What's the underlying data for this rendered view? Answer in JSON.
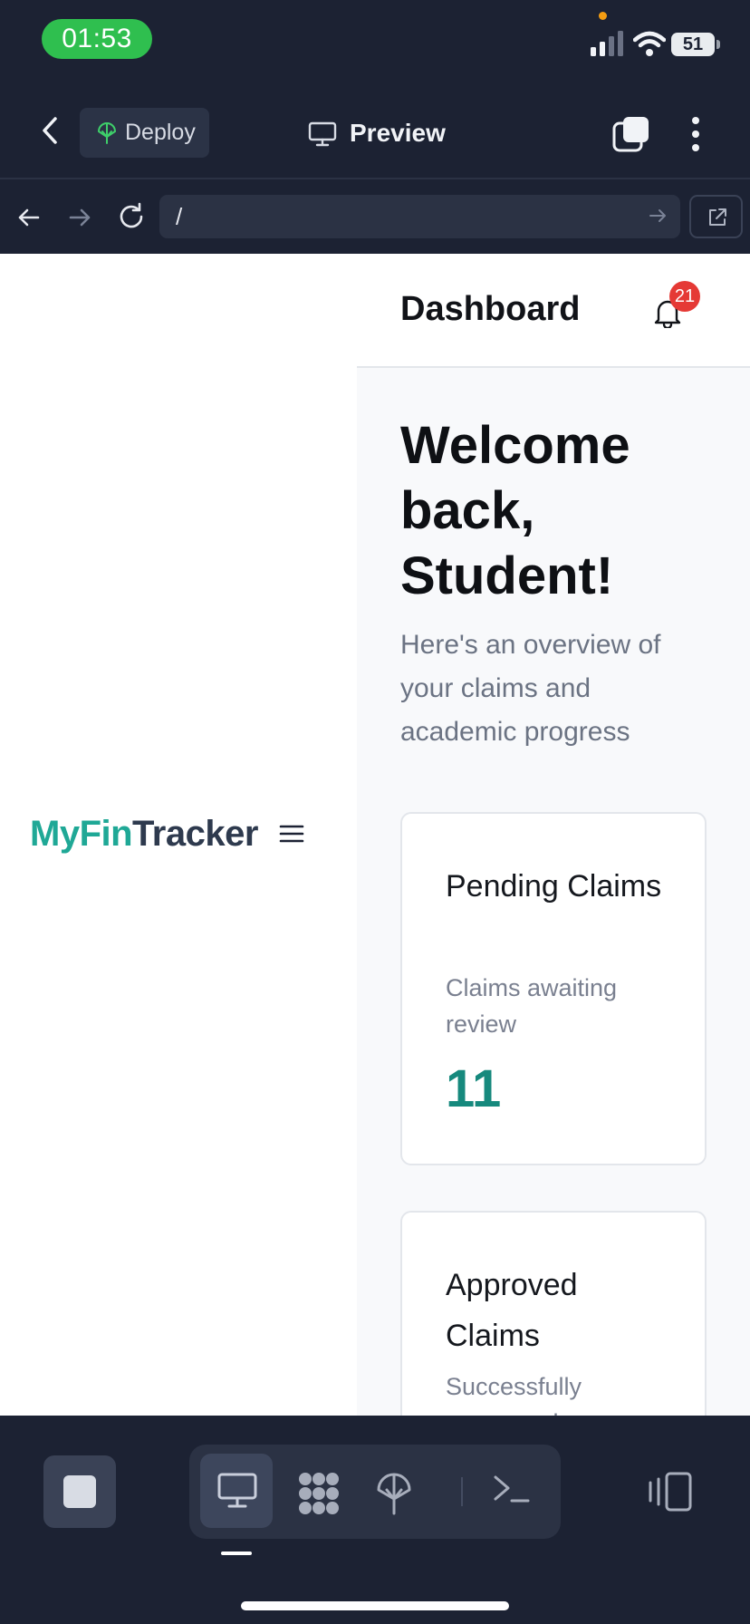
{
  "status_bar": {
    "time": "01:53",
    "battery": "51",
    "icons": [
      "signal-icon",
      "wifi-icon",
      "battery-icon"
    ]
  },
  "app_header": {
    "back_icon": "chevron-left-icon",
    "deploy_label": "Deploy",
    "deploy_icon": "deploy-icon",
    "title": "Preview",
    "title_icon": "monitor-icon",
    "tabs_icon": "tabs-icon",
    "more_icon": "more-vertical-icon"
  },
  "url_bar": {
    "url": "/",
    "icons": [
      "arrow-left-icon",
      "arrow-right-icon",
      "reload-icon",
      "arrow-right-icon",
      "external-link-icon"
    ]
  },
  "sidebar": {
    "brand_part1": "MyFin",
    "brand_part2": "Tracker",
    "menu_icon": "hamburger-icon"
  },
  "main": {
    "page_title": "Dashboard",
    "notification_count": "21",
    "welcome": "Welcome back, Student!",
    "subtitle": "Here's an overview of your claims and academic progress",
    "cards": [
      {
        "title": "Pending Claims",
        "description": "Claims awaiting review",
        "value": "11"
      },
      {
        "title": "Approved Claims",
        "description": "Successfully processed"
      }
    ]
  },
  "dock": {
    "modes": [
      "monitor-icon",
      "nodes-icon",
      "deploy-icon",
      "terminal-icon"
    ],
    "active_mode": "monitor-icon"
  },
  "colors": {
    "brand_primary": "#1fa896",
    "brand_dark": "#2e3a4e",
    "value_accent": "#16897d",
    "badge": "#e53935",
    "chrome_bg": "#1c2233",
    "time_pill": "#2fbf4f"
  }
}
